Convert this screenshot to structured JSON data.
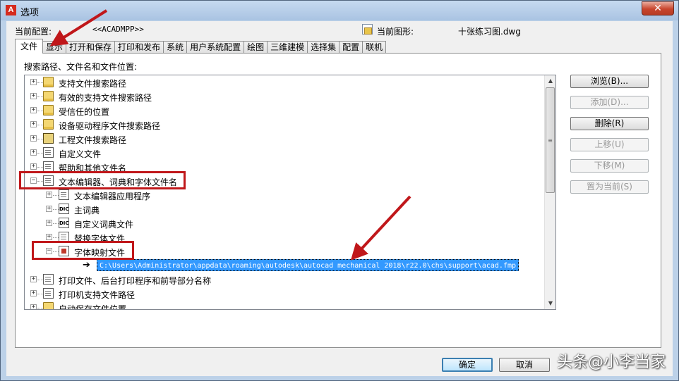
{
  "window": {
    "title": "选项",
    "close_glyph": "✕",
    "app_icon": "A"
  },
  "header": {
    "profile_label": "当前配置:",
    "profile_value": "<<ACADMPP>>",
    "drawing_label": "当前图形:",
    "drawing_value": "十张练习图.dwg"
  },
  "tabs": [
    "文件",
    "显示",
    "打开和保存",
    "打印和发布",
    "系统",
    "用户系统配置",
    "绘图",
    "三维建模",
    "选择集",
    "配置",
    "联机"
  ],
  "panel": {
    "label": "搜索路径、文件名和文件位置:",
    "tree": [
      {
        "text": "支持文件搜索路径",
        "level": 0,
        "icon": "folder-icon",
        "expander": "+"
      },
      {
        "text": "有效的支持文件搜索路径",
        "level": 0,
        "icon": "folder-icon",
        "expander": "+"
      },
      {
        "text": "受信任的位置",
        "level": 0,
        "icon": "folder-icon",
        "expander": "+"
      },
      {
        "text": "设备驱动程序文件搜索路径",
        "level": 0,
        "icon": "folder-icon",
        "expander": "+"
      },
      {
        "text": "工程文件搜索路径",
        "level": 0,
        "icon": "book-icon",
        "expander": "+"
      },
      {
        "text": "自定义文件",
        "level": 0,
        "icon": "document-icon",
        "expander": "+"
      },
      {
        "text": "帮助和其他文件名",
        "level": 0,
        "icon": "document-icon",
        "expander": "+"
      },
      {
        "text": "文本编辑器、词典和字体文件名",
        "level": 0,
        "icon": "document-icon",
        "expander": "−"
      },
      {
        "text": "文本编辑器应用程序",
        "level": 1,
        "icon": "editor-icon",
        "expander": "+"
      },
      {
        "text": "主词典",
        "level": 1,
        "icon": "dictionary-icon",
        "expander": "+"
      },
      {
        "text": "自定义词典文件",
        "level": 1,
        "icon": "dictionary-icon",
        "expander": "+"
      },
      {
        "text": "替换字体文件",
        "level": 1,
        "icon": "font-icon",
        "expander": "+"
      },
      {
        "text": "字体映射文件",
        "level": 1,
        "icon": "font-map-icon",
        "expander": "−"
      },
      {
        "text": "C:\\Users\\Administrator\\appdata\\roaming\\autodesk\\autocad mechanical 2018\\r22.0\\chs\\support\\acad.fmp",
        "level": 2,
        "icon": "arrow-icon",
        "expander": "",
        "selected": true
      },
      {
        "text": "打印文件、后台打印程序和前导部分名称",
        "level": 0,
        "icon": "document-icon",
        "expander": "+"
      },
      {
        "text": "打印机支持文件路径",
        "level": 0,
        "icon": "document-icon",
        "expander": "+"
      },
      {
        "text": "自动保存文件位置",
        "level": 0,
        "icon": "folder-icon",
        "expander": "+"
      }
    ]
  },
  "side_buttons": [
    {
      "label": "浏览(B)...",
      "enabled": true
    },
    {
      "label": "添加(D)...",
      "enabled": false
    },
    {
      "label": "删除(R)",
      "enabled": true
    },
    {
      "label": "上移(U)",
      "enabled": false
    },
    {
      "label": "下移(M)",
      "enabled": false
    },
    {
      "label": "置为当前(S)",
      "enabled": false
    }
  ],
  "footer": {
    "ok": "确定",
    "cancel": "取消"
  },
  "watermark": "头条@小李当家",
  "colors": {
    "annotation": "#c0171a",
    "selection": "#3399ff"
  }
}
